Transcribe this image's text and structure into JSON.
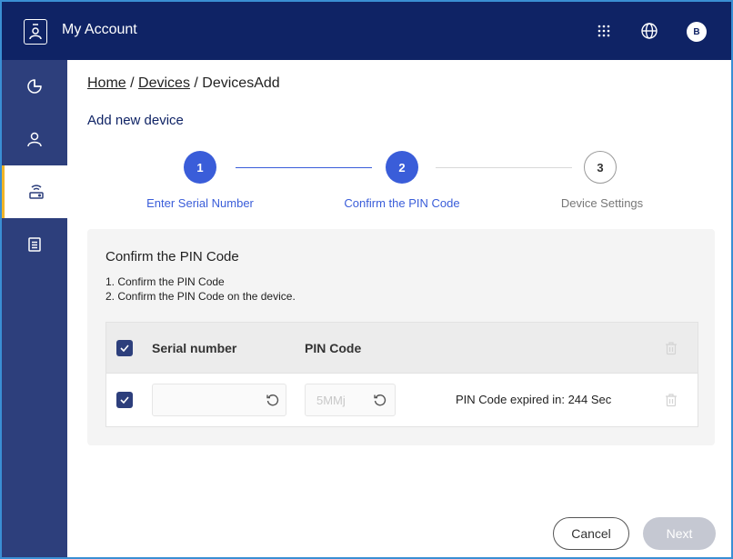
{
  "header": {
    "title": "My Account",
    "avatar_initial": "B"
  },
  "breadcrumb": {
    "home": "Home",
    "sep1": " / ",
    "devices": "Devices",
    "sep2": " / ",
    "current": "DevicesAdd"
  },
  "page_title": "Add new device",
  "stepper": {
    "steps": [
      {
        "number": "1",
        "label": "Enter Serial Number",
        "state": "complete"
      },
      {
        "number": "2",
        "label": "Confirm the PIN Code",
        "state": "current"
      },
      {
        "number": "3",
        "label": "Device Settings",
        "state": "pending"
      }
    ]
  },
  "card": {
    "title": "Confirm the PIN Code",
    "instructions": [
      "1. Confirm the PIN Code",
      "2. Confirm the PIN Code on the device."
    ]
  },
  "table": {
    "columns": [
      "Serial number",
      "PIN Code"
    ],
    "rows": [
      {
        "serial": "",
        "pin": "5MMj",
        "expiry": "PIN Code expired in: 244 Sec",
        "checked": true
      }
    ]
  },
  "buttons": {
    "cancel": "Cancel",
    "next": "Next"
  },
  "colors": {
    "header_bg": "#0f2365",
    "sidebar_bg": "#2d3f7c",
    "accent": "#3a5dd9",
    "active_marker": "#f0b429"
  }
}
